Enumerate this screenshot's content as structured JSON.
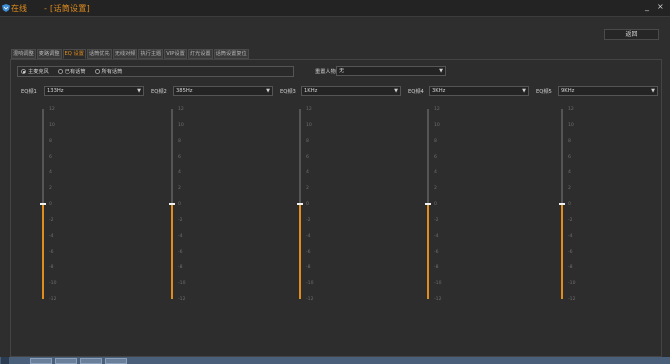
{
  "titlebar": {
    "status": "在线",
    "title": "- [话筒设置]",
    "minimize": "_",
    "close": "×",
    "icon": "shield-icon"
  },
  "back_button": "返回",
  "tabs": [
    {
      "label": "混响调整"
    },
    {
      "label": "麦路调整"
    },
    {
      "label": "EQ 设置",
      "active": true
    },
    {
      "label": "话筒优先"
    },
    {
      "label": "无线对频"
    },
    {
      "label": "执行主题"
    },
    {
      "label": "VIP设置"
    },
    {
      "label": "灯光设置"
    },
    {
      "label": "话筒设置复位"
    }
  ],
  "mode": {
    "options": [
      {
        "label": "主麦克风",
        "checked": true
      },
      {
        "label": "已有话筒",
        "checked": false
      },
      {
        "label": "所有话筒",
        "checked": false
      }
    ]
  },
  "preset": {
    "label": "重置人物",
    "value": "无"
  },
  "eq_bands": [
    {
      "label": "EQ频1",
      "freq": "133Hz",
      "level": 0
    },
    {
      "label": "EQ频2",
      "freq": "385Hz",
      "level": 0
    },
    {
      "label": "EQ频3",
      "freq": "1KHz",
      "level": 0
    },
    {
      "label": "EQ频4",
      "freq": "3KHz",
      "level": 0
    },
    {
      "label": "EQ频5",
      "freq": "9KHz",
      "level": 0
    }
  ],
  "ticks": [
    "12",
    "10",
    "8",
    "6",
    "4",
    "2",
    "0",
    "-2",
    "-4",
    "-6",
    "-8",
    "-10",
    "-12"
  ],
  "colors": {
    "accent": "#e18d1e",
    "background": "#2e2e2e"
  }
}
